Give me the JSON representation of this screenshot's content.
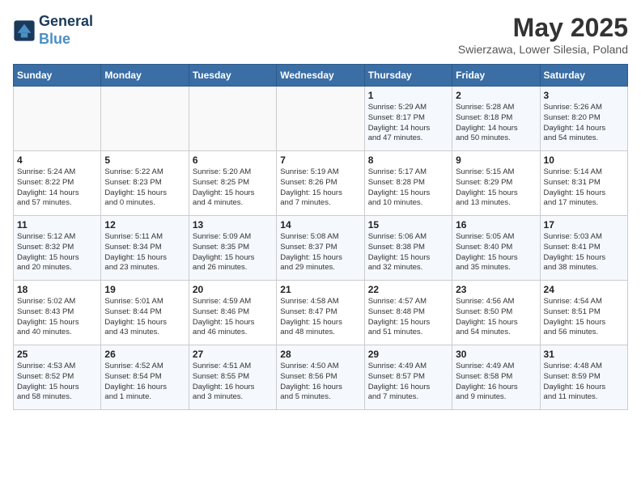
{
  "header": {
    "logo_line1": "General",
    "logo_line2": "Blue",
    "month_title": "May 2025",
    "location": "Swierzawa, Lower Silesia, Poland"
  },
  "weekdays": [
    "Sunday",
    "Monday",
    "Tuesday",
    "Wednesday",
    "Thursday",
    "Friday",
    "Saturday"
  ],
  "weeks": [
    [
      {
        "day": "",
        "info": ""
      },
      {
        "day": "",
        "info": ""
      },
      {
        "day": "",
        "info": ""
      },
      {
        "day": "",
        "info": ""
      },
      {
        "day": "1",
        "info": "Sunrise: 5:29 AM\nSunset: 8:17 PM\nDaylight: 14 hours\nand 47 minutes."
      },
      {
        "day": "2",
        "info": "Sunrise: 5:28 AM\nSunset: 8:18 PM\nDaylight: 14 hours\nand 50 minutes."
      },
      {
        "day": "3",
        "info": "Sunrise: 5:26 AM\nSunset: 8:20 PM\nDaylight: 14 hours\nand 54 minutes."
      }
    ],
    [
      {
        "day": "4",
        "info": "Sunrise: 5:24 AM\nSunset: 8:22 PM\nDaylight: 14 hours\nand 57 minutes."
      },
      {
        "day": "5",
        "info": "Sunrise: 5:22 AM\nSunset: 8:23 PM\nDaylight: 15 hours\nand 0 minutes."
      },
      {
        "day": "6",
        "info": "Sunrise: 5:20 AM\nSunset: 8:25 PM\nDaylight: 15 hours\nand 4 minutes."
      },
      {
        "day": "7",
        "info": "Sunrise: 5:19 AM\nSunset: 8:26 PM\nDaylight: 15 hours\nand 7 minutes."
      },
      {
        "day": "8",
        "info": "Sunrise: 5:17 AM\nSunset: 8:28 PM\nDaylight: 15 hours\nand 10 minutes."
      },
      {
        "day": "9",
        "info": "Sunrise: 5:15 AM\nSunset: 8:29 PM\nDaylight: 15 hours\nand 13 minutes."
      },
      {
        "day": "10",
        "info": "Sunrise: 5:14 AM\nSunset: 8:31 PM\nDaylight: 15 hours\nand 17 minutes."
      }
    ],
    [
      {
        "day": "11",
        "info": "Sunrise: 5:12 AM\nSunset: 8:32 PM\nDaylight: 15 hours\nand 20 minutes."
      },
      {
        "day": "12",
        "info": "Sunrise: 5:11 AM\nSunset: 8:34 PM\nDaylight: 15 hours\nand 23 minutes."
      },
      {
        "day": "13",
        "info": "Sunrise: 5:09 AM\nSunset: 8:35 PM\nDaylight: 15 hours\nand 26 minutes."
      },
      {
        "day": "14",
        "info": "Sunrise: 5:08 AM\nSunset: 8:37 PM\nDaylight: 15 hours\nand 29 minutes."
      },
      {
        "day": "15",
        "info": "Sunrise: 5:06 AM\nSunset: 8:38 PM\nDaylight: 15 hours\nand 32 minutes."
      },
      {
        "day": "16",
        "info": "Sunrise: 5:05 AM\nSunset: 8:40 PM\nDaylight: 15 hours\nand 35 minutes."
      },
      {
        "day": "17",
        "info": "Sunrise: 5:03 AM\nSunset: 8:41 PM\nDaylight: 15 hours\nand 38 minutes."
      }
    ],
    [
      {
        "day": "18",
        "info": "Sunrise: 5:02 AM\nSunset: 8:43 PM\nDaylight: 15 hours\nand 40 minutes."
      },
      {
        "day": "19",
        "info": "Sunrise: 5:01 AM\nSunset: 8:44 PM\nDaylight: 15 hours\nand 43 minutes."
      },
      {
        "day": "20",
        "info": "Sunrise: 4:59 AM\nSunset: 8:46 PM\nDaylight: 15 hours\nand 46 minutes."
      },
      {
        "day": "21",
        "info": "Sunrise: 4:58 AM\nSunset: 8:47 PM\nDaylight: 15 hours\nand 48 minutes."
      },
      {
        "day": "22",
        "info": "Sunrise: 4:57 AM\nSunset: 8:48 PM\nDaylight: 15 hours\nand 51 minutes."
      },
      {
        "day": "23",
        "info": "Sunrise: 4:56 AM\nSunset: 8:50 PM\nDaylight: 15 hours\nand 54 minutes."
      },
      {
        "day": "24",
        "info": "Sunrise: 4:54 AM\nSunset: 8:51 PM\nDaylight: 15 hours\nand 56 minutes."
      }
    ],
    [
      {
        "day": "25",
        "info": "Sunrise: 4:53 AM\nSunset: 8:52 PM\nDaylight: 15 hours\nand 58 minutes."
      },
      {
        "day": "26",
        "info": "Sunrise: 4:52 AM\nSunset: 8:54 PM\nDaylight: 16 hours\nand 1 minute."
      },
      {
        "day": "27",
        "info": "Sunrise: 4:51 AM\nSunset: 8:55 PM\nDaylight: 16 hours\nand 3 minutes."
      },
      {
        "day": "28",
        "info": "Sunrise: 4:50 AM\nSunset: 8:56 PM\nDaylight: 16 hours\nand 5 minutes."
      },
      {
        "day": "29",
        "info": "Sunrise: 4:49 AM\nSunset: 8:57 PM\nDaylight: 16 hours\nand 7 minutes."
      },
      {
        "day": "30",
        "info": "Sunrise: 4:49 AM\nSunset: 8:58 PM\nDaylight: 16 hours\nand 9 minutes."
      },
      {
        "day": "31",
        "info": "Sunrise: 4:48 AM\nSunset: 8:59 PM\nDaylight: 16 hours\nand 11 minutes."
      }
    ]
  ]
}
